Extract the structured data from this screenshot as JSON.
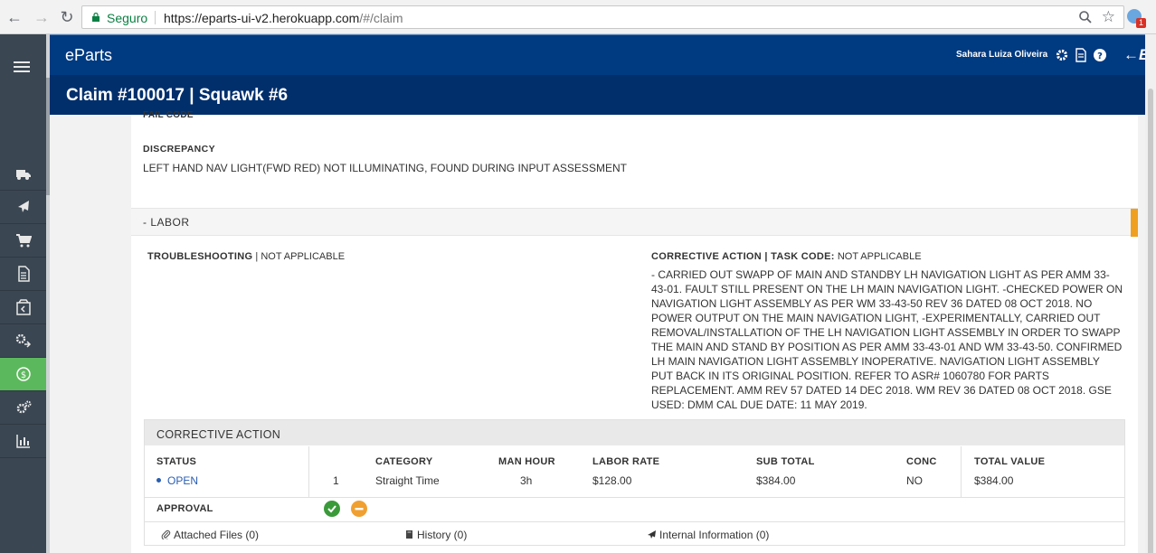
{
  "browser": {
    "secure_label": "Seguro",
    "url_host": "https://eparts-ui-v2.herokuapp.com",
    "url_path": "/#/claim",
    "extension_badge": "1"
  },
  "app": {
    "logo": "eParts",
    "user_name": "Sahara Luiza Oliveira",
    "brand_mark": "E",
    "page_title": "Claim #100017 | Squawk #6"
  },
  "sidebar": {
    "items": [
      {
        "icon": "truck-icon"
      },
      {
        "icon": "airplane-icon"
      },
      {
        "icon": "cart-icon"
      },
      {
        "icon": "document-icon"
      },
      {
        "icon": "box-return-icon"
      },
      {
        "icon": "gears-exchange-icon"
      },
      {
        "icon": "dollar-refund-icon",
        "active": true
      },
      {
        "icon": "settings-gears-icon"
      },
      {
        "icon": "bar-chart-icon"
      }
    ]
  },
  "squawk": {
    "fail_code_label": "FAIL CODE",
    "discrepancy_label": "DISCREPANCY",
    "discrepancy_text": "LEFT HAND NAV LIGHT(FWD RED) NOT ILLUMINATING, FOUND DURING INPUT ASSESSMENT"
  },
  "labor": {
    "section_title": "- LABOR",
    "troubleshooting_label": "TROUBLESHOOTING",
    "troubleshooting_value": "NOT APPLICABLE",
    "corrective_action_label": "CORRECTIVE ACTION | TASK CODE:",
    "task_code_value": "NOT APPLICABLE",
    "corrective_action_text": "- CARRIED OUT SWAPP OF MAIN AND STANDBY LH NAVIGATION LIGHT AS PER AMM 33-43-01. FAULT STILL PRESENT ON THE LH MAIN NAVIGATION LIGHT. -CHECKED POWER ON NAVIGATION LIGHT ASSEMBLY AS PER WM 33-43-50 REV 36 DATED 08 OCT 2018. NO POWER OUTPUT ON THE MAIN NAVIGATION LIGHT, -EXPERIMENTALLY, CARRIED OUT REMOVAL/INSTALLATION OF THE LH NAVIGATION LIGHT ASSEMBLY IN ORDER TO SWAPP THE MAIN AND STAND BY POSITION AS PER AMM 33-43-01 AND WM 33-43-50. CONFIRMED LH MAIN NAVIGATION LIGHT ASSEMBLY INOPERATIVE. NAVIGATION LIGHT ASSEMBLY PUT BACK IN ITS ORIGINAL POSITION. REFER TO ASR# 1060780 FOR PARTS REPLACEMENT. AMM REV 57 DATED 14 DEC 2018. WM REV 36 DATED 08 OCT 2018. GSE USED: DMM CAL DUE DATE: 11 MAY 2019."
  },
  "corrective_panel": {
    "title": "CORRECTIVE ACTION",
    "headers": {
      "status": "STATUS",
      "category": "CATEGORY",
      "man_hour": "MAN HOUR",
      "labor_rate": "LABOR RATE",
      "sub_total": "SUB TOTAL",
      "conc": "CONC",
      "total_value": "TOTAL VALUE"
    },
    "row": {
      "status": "OPEN",
      "index": "1",
      "category": "Straight Time",
      "man_hour": "3h",
      "labor_rate": "$128.00",
      "sub_total": "$384.00",
      "conc": "NO",
      "total_value": "$384.00"
    },
    "approval_label": "APPROVAL",
    "links": {
      "attached_files": "Attached Files (0)",
      "history": "History (0)",
      "internal_information": "Internal Information (0)"
    }
  },
  "colors": {
    "header_blue": "#003a80",
    "title_blue": "#002f6c",
    "sidebar": "#3a4652",
    "active_green": "#5cb85c",
    "accent_orange": "#f0a020"
  }
}
